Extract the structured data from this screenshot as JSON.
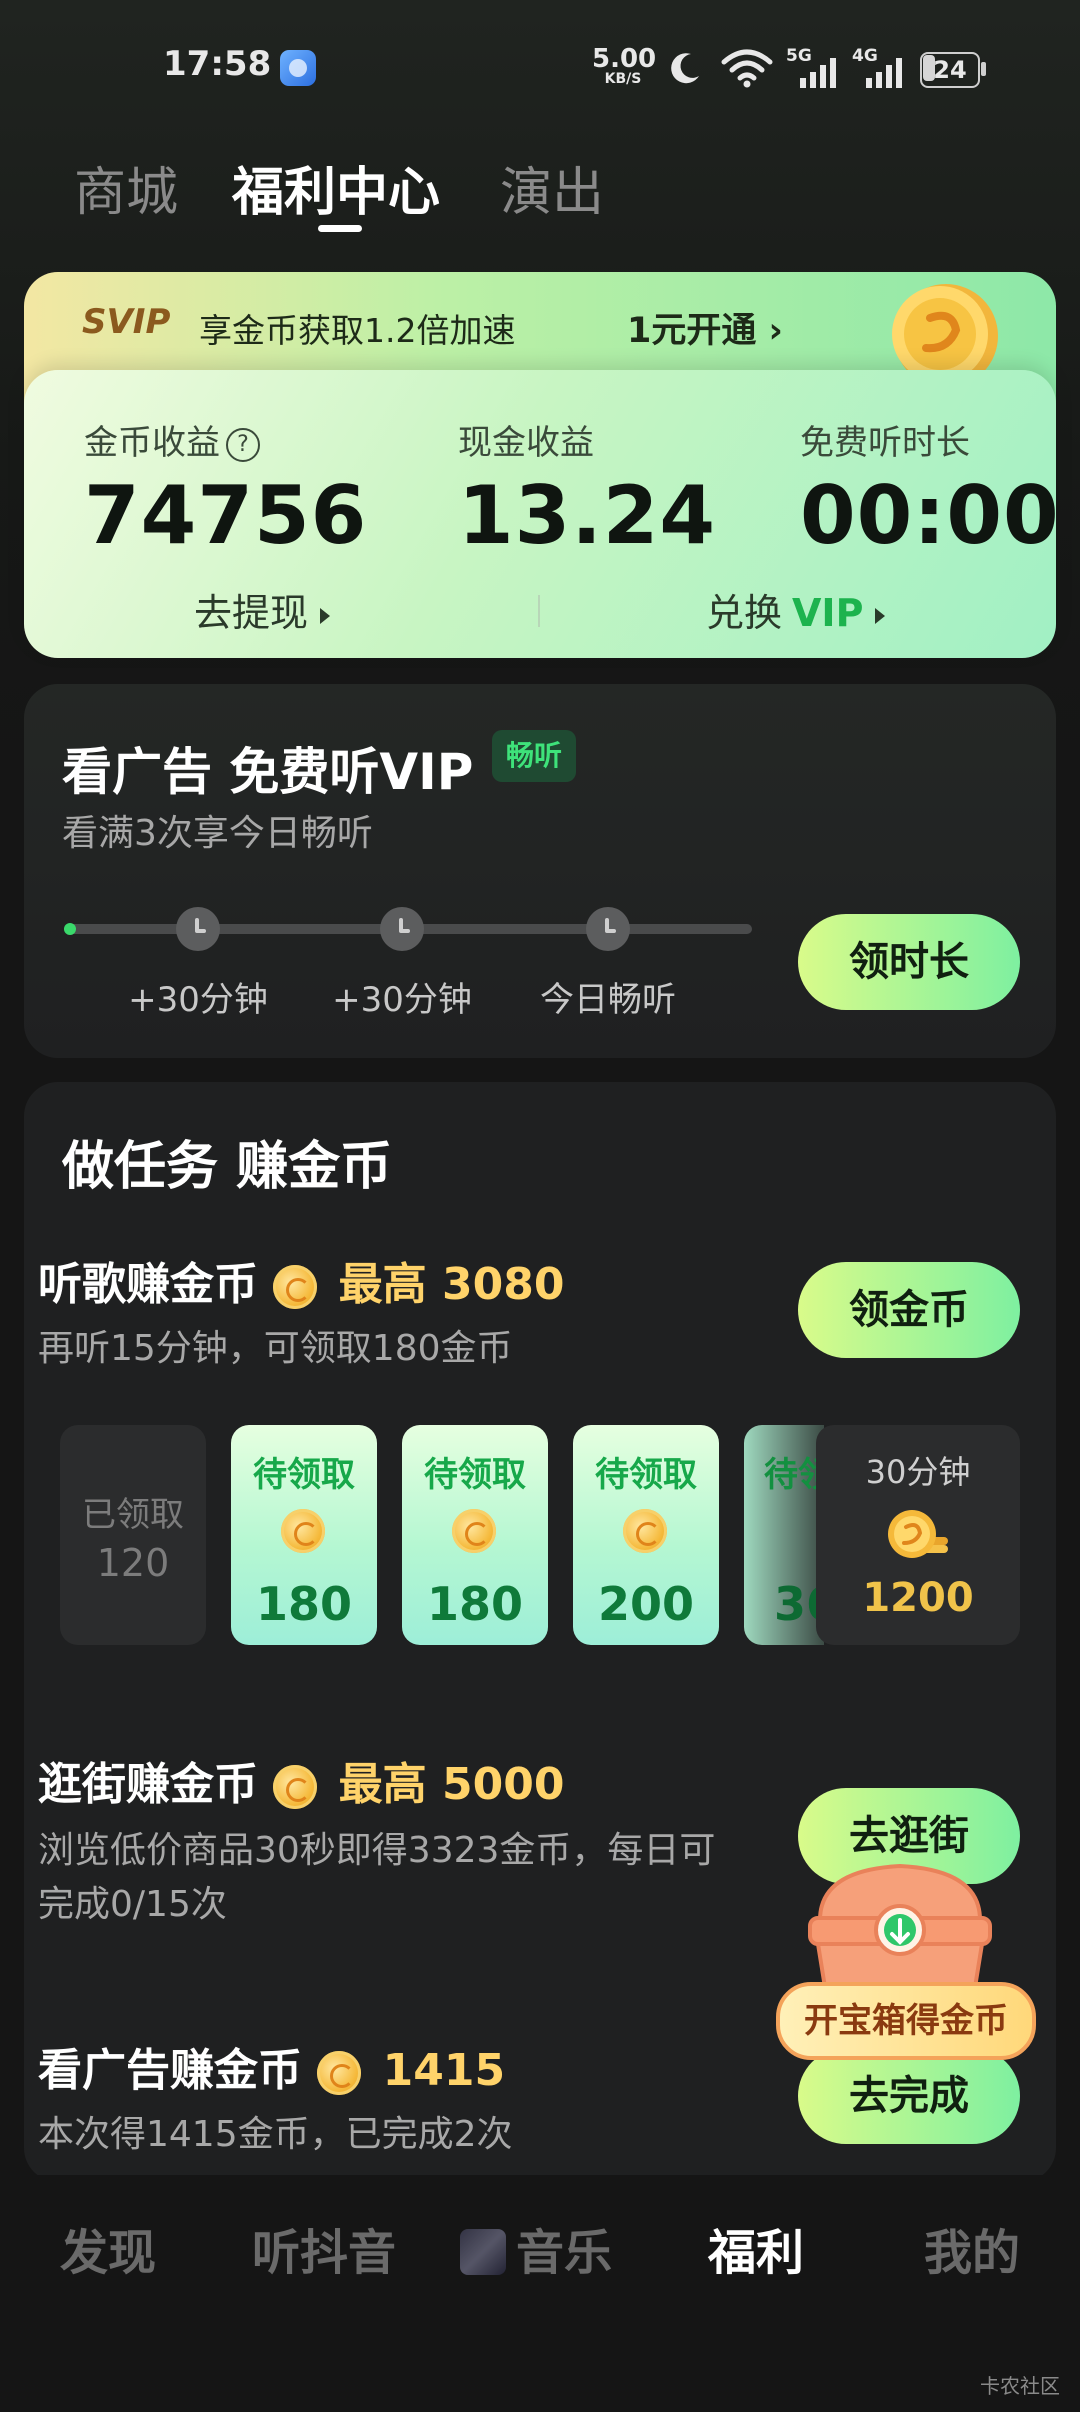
{
  "status_bar": {
    "time": "17:58",
    "net_speed": "5.00",
    "net_unit": "KB/S",
    "sig1": "5G",
    "sig2": "4G",
    "battery": "24"
  },
  "top_tabs": [
    {
      "label": "商城",
      "active": false
    },
    {
      "label": "福利中心",
      "active": true
    },
    {
      "label": "演出",
      "active": false
    }
  ],
  "svip_banner": {
    "tag": "SVIP",
    "text": "享金币获取1.2倍加速",
    "cta": "1元开通 ›"
  },
  "earnings": {
    "coin_label": "金币收益",
    "coin_value": "74756",
    "cash_label": "现金收益",
    "cash_value": "13.24",
    "free_label": "免费听时长",
    "free_value": "00:00",
    "withdraw": "去提现",
    "exchange": "兑换",
    "exchange_vip": "VIP"
  },
  "vip_card": {
    "title": "看广告 免费听VIP",
    "badge": "畅听",
    "subtitle": "看满3次享今日畅听",
    "steps": [
      "+30分钟",
      "+30分钟",
      "今日畅听"
    ],
    "progress": 0.0,
    "button": "领时长"
  },
  "tasks": {
    "title": "做任务 赚金币",
    "music": {
      "title": "听歌赚金币",
      "max": "最高 3080",
      "sub": "再听15分钟，可领取180金币",
      "button": "领金币",
      "slots": [
        {
          "status": "已领取",
          "amount": "120"
        },
        {
          "status": "待领取",
          "amount": "180"
        },
        {
          "status": "待领取",
          "amount": "180"
        },
        {
          "status": "待领取",
          "amount": "200"
        },
        {
          "status": "待领取",
          "amount": "360"
        }
      ],
      "big_slot": {
        "label": "30分钟",
        "amount": "1200"
      }
    },
    "shop": {
      "title": "逛街赚金币",
      "max": "最高 5000",
      "sub": "浏览低价商品30秒即得3323金币，每日可完成0/15次",
      "button": "去逛街"
    },
    "ads": {
      "title": "看广告赚金币",
      "max": "1415",
      "sub": "本次得1415金币，已完成2次",
      "button": "去完成"
    }
  },
  "chest": {
    "label": "开宝箱得金币"
  },
  "bottom_nav": [
    {
      "label": "发现",
      "active": false
    },
    {
      "label": "听抖音",
      "active": false
    },
    {
      "label": "音乐",
      "active": false
    },
    {
      "label": "福利",
      "active": true
    },
    {
      "label": "我的",
      "active": false
    }
  ],
  "watermark": "卡农社区",
  "colors": {
    "accent_green": "#3ee27a",
    "gold": "#ffd36a",
    "card_bg": "#1f2021"
  }
}
